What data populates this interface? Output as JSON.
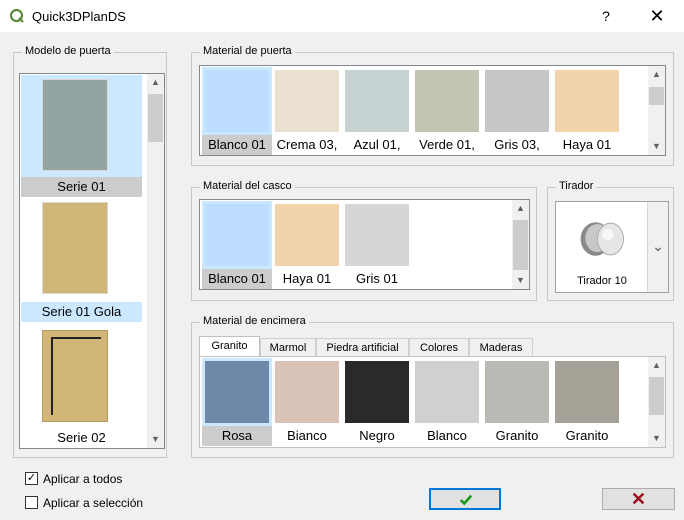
{
  "window": {
    "title": "Quick3DPlanDS",
    "help": "?",
    "close": "✕"
  },
  "door_model": {
    "label": "Modelo de puerta",
    "items": [
      {
        "label": "Serie 01",
        "selected": true
      },
      {
        "label": "Serie 01 Gola",
        "selected": false
      },
      {
        "label": "Serie 02",
        "selected": false
      }
    ]
  },
  "door_material": {
    "label": "Material de puerta",
    "items": [
      {
        "label": "Blanco 01",
        "color": "#bfddfe",
        "selected": true
      },
      {
        "label": "Crema 03,",
        "color": "#e9e0d0",
        "selected": false
      },
      {
        "label": "Azul 01,",
        "color": "#c6d3d2",
        "selected": false
      },
      {
        "label": "Verde 01,",
        "color": "#c4c4b4",
        "selected": false
      },
      {
        "label": "Gris 03,",
        "color": "#c7c7c7",
        "selected": false
      },
      {
        "label": "Haya 01",
        "color": "#f3d3ac",
        "selected": false
      }
    ]
  },
  "carcass_material": {
    "label": "Material del casco",
    "items": [
      {
        "label": "Blanco 01",
        "color": "#bfddfe",
        "selected": true
      },
      {
        "label": "Haya 01",
        "color": "#f3d3ac",
        "selected": false
      },
      {
        "label": "Gris 01",
        "color": "#d6d6d6",
        "selected": false
      }
    ]
  },
  "handle": {
    "label": "Tirador",
    "selected": "Tirador 10"
  },
  "countertop": {
    "label": "Material de encimera",
    "tabs": [
      "Granito",
      "Marmol",
      "Piedra artificial",
      "Colores",
      "Maderas"
    ],
    "active_tab": "Granito",
    "items": [
      {
        "label": "Rosa",
        "color": "#6e88aa",
        "selected": true
      },
      {
        "label": "Bianco",
        "color": "#d9c2b6",
        "selected": false
      },
      {
        "label": "Negro",
        "color": "#2a2a2a",
        "selected": false
      },
      {
        "label": "Blanco",
        "color": "#d0d0d0",
        "selected": false
      },
      {
        "label": "Granito",
        "color": "#b8bab4",
        "selected": false
      },
      {
        "label": "Granito",
        "color": "#a7a298",
        "selected": false
      }
    ]
  },
  "options": {
    "apply_all": {
      "label": "Aplicar a todos",
      "checked": true
    },
    "apply_selection": {
      "label": "Aplicar a selección",
      "checked": false
    }
  },
  "buttons": {
    "ok_icon": "check-icon",
    "cancel_icon": "cross-icon"
  }
}
